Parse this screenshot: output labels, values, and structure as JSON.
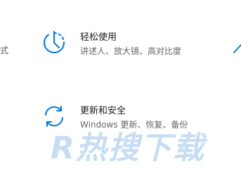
{
  "left_edge_text": "式",
  "tiles": [
    {
      "title": "轻松使用",
      "description": "讲述人、放大镜、高对比度",
      "icon": "ease-of-access-icon"
    },
    {
      "title": "更新和安全",
      "description": "Windows 更新、恢复、备份",
      "icon": "update-sync-icon"
    }
  ],
  "watermark": {
    "logo_text": "R热搜下载"
  },
  "colors": {
    "accent": "#0078d7",
    "watermark": "#bcd7f2"
  }
}
